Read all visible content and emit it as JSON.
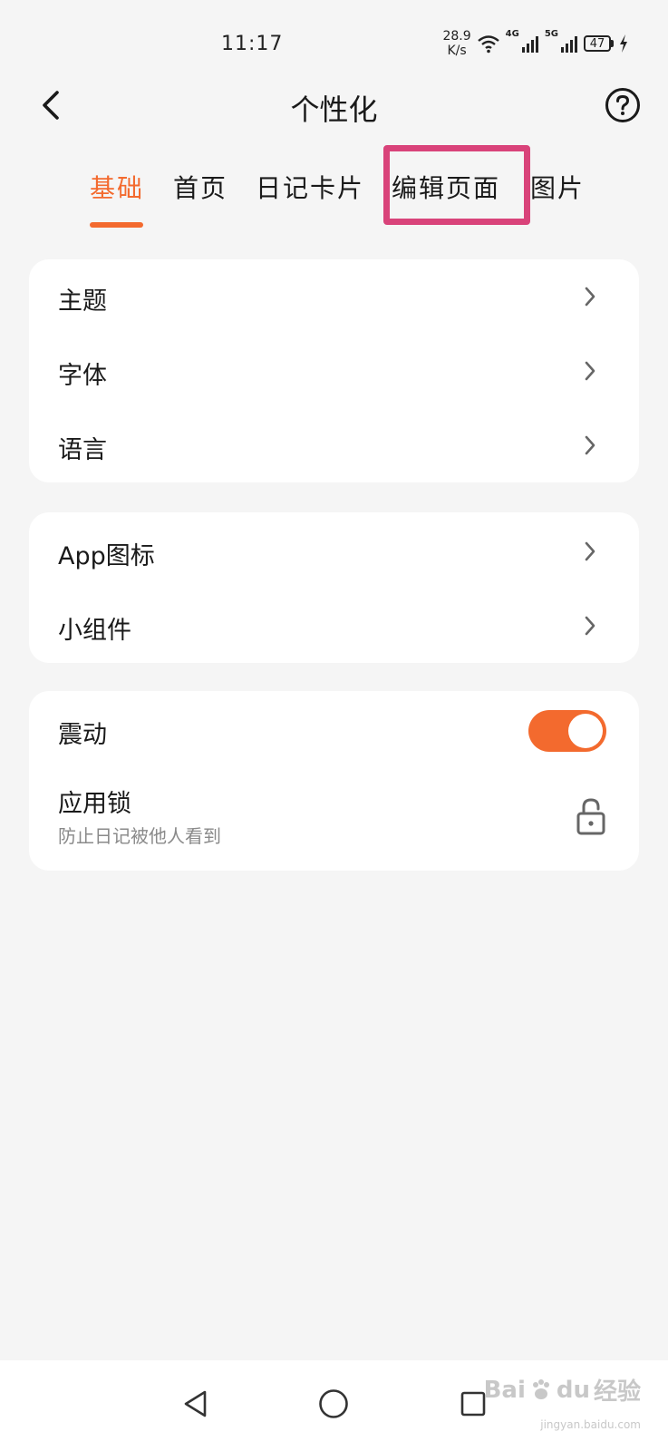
{
  "status_bar": {
    "time": "11:17",
    "net_speed_value": "28.9",
    "net_speed_unit": "K/s",
    "signal_1_tag": "4G",
    "signal_2_tag": "5G",
    "battery": "47"
  },
  "header": {
    "title": "个性化"
  },
  "tabs": [
    {
      "label": "基础",
      "active": true
    },
    {
      "label": "首页",
      "active": false
    },
    {
      "label": "日记卡片",
      "active": false
    },
    {
      "label": "编辑页面",
      "active": false
    },
    {
      "label": "图片",
      "active": false
    }
  ],
  "groups": {
    "appearance": {
      "theme": "主题",
      "font": "字体",
      "language": "语言"
    },
    "app": {
      "app_icon": "App图标",
      "widget": "小组件"
    },
    "system": {
      "vibration": "震动",
      "vibration_on": true,
      "app_lock": "应用锁",
      "app_lock_desc": "防止日记被他人看到"
    }
  },
  "watermark": {
    "brand": "Bai",
    "brand_suffix": "du",
    "brand_cn": "经验",
    "url": "jingyan.baidu.com"
  },
  "colors": {
    "accent": "#f36a2e",
    "highlight": "#d9437a",
    "background": "#f5f5f5",
    "card": "#ffffff"
  }
}
